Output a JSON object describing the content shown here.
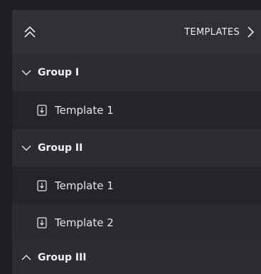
{
  "header": {
    "title": "TEMPLATES"
  },
  "groups": [
    {
      "label": "Group I",
      "expanded": true,
      "templates": [
        {
          "label": "Template 1"
        }
      ]
    },
    {
      "label": "Group II",
      "expanded": true,
      "templates": [
        {
          "label": "Template 1"
        },
        {
          "label": "Template 2"
        }
      ]
    },
    {
      "label": "Group III",
      "expanded": false,
      "templates": []
    }
  ],
  "colors": {
    "background": "#1f1e22",
    "panel": "#252429",
    "header": "#313036",
    "group_row": "#2d2c32",
    "text": "#e8e8ea"
  },
  "icons": {
    "collapse_all": "double-chevron-up-icon",
    "header_expand": "chevron-right-icon",
    "group_expanded": "chevron-down-icon",
    "group_collapsed": "chevron-up-icon",
    "template": "document-download-icon"
  }
}
